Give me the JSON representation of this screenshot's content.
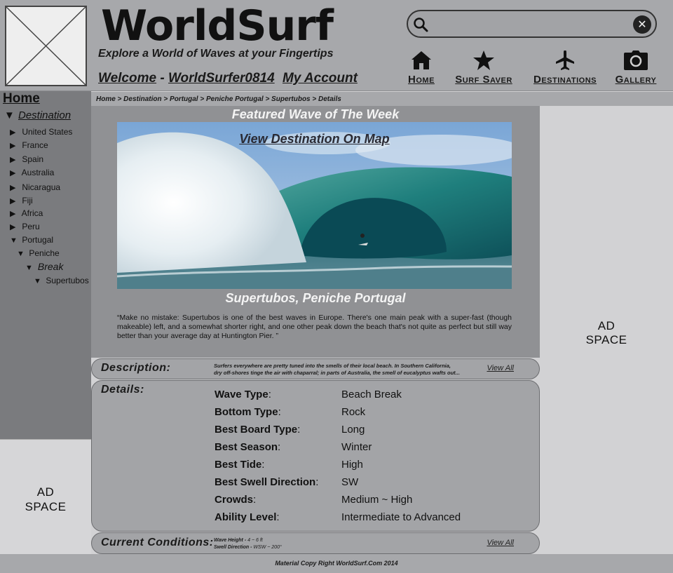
{
  "header": {
    "brand": "WorldSurf",
    "tagline": "Explore a World of Waves at your Fingertips",
    "welcome_prefix": "Welcome",
    "welcome_separator": "-",
    "username": "WorldSurfer0814",
    "account_link": "My Account",
    "search": {
      "placeholder": "",
      "value": ""
    },
    "nav": [
      {
        "label": "Home",
        "icon": "home-icon"
      },
      {
        "label": "Surf Saver",
        "icon": "star-icon"
      },
      {
        "label": "Destinations",
        "icon": "airplane-icon"
      },
      {
        "label": "Gallery",
        "icon": "camera-icon"
      }
    ]
  },
  "sidebar": {
    "home": "Home",
    "destination_label": "Destination",
    "countries": [
      "United States",
      "France",
      "Spain",
      "Australia",
      "Nicaragua",
      "Fiji",
      "Africa",
      "Peru",
      "Portugal"
    ],
    "sub_region": "Peniche",
    "sub_category": "Break",
    "sub_spot": "Supertubos",
    "ad": [
      "AD",
      "SPACE"
    ]
  },
  "breadcrumb": "Home > Destination > Portugal > Peniche Portugal > Supertubos > Details",
  "featured": {
    "title": "Featured Wave of The Week",
    "map_link": "View Destination On Map",
    "caption": "Supertubos, Peniche Portugal",
    "quote": "“Make no mistake: Supertubos is one of the best waves in Europe. There's one main peak with a super-fast (though makeable) left, and a somewhat shorter right, and one other peak down the beach that's not quite as perfect but still way better than your average day at Huntington Pier. ”"
  },
  "description": {
    "label": "Description:",
    "text_line1": "Surfers everywhere are pretty tuned into the smells of their local beach. In Southern California,",
    "text_line2": "dry off-shores tinge the air with chaparral; in parts of Australia, the smell of eucalyptus wafts out...",
    "view_all": "View All"
  },
  "details": {
    "label": "Details:",
    "rows": [
      {
        "key": "Wave Type",
        "value": "Beach Break"
      },
      {
        "key": "Bottom Type",
        "value": "Rock"
      },
      {
        "key": "Best Board Type",
        "value": "Long"
      },
      {
        "key": "Best Season",
        "value": "Winter"
      },
      {
        "key": "Best Tide",
        "value": "High"
      },
      {
        "key": "Best Swell Direction",
        "value": "SW"
      },
      {
        "key": "Crowds",
        "value": "Medium ~ High"
      },
      {
        "key": "Ability Level",
        "value": "Intermediate to Advanced"
      }
    ]
  },
  "conditions": {
    "label": "Current Conditions:",
    "wave_height_key": "Wave Height",
    "wave_height": "4 ~ 6 ft",
    "swell_direction_key": "Swell Direction",
    "swell_direction": "WSW ~ 200°",
    "view_all": "View All"
  },
  "ad_right": [
    "AD",
    "SPACE"
  ],
  "footer": "Material Copy Right WorldSurf.Com 2014"
}
